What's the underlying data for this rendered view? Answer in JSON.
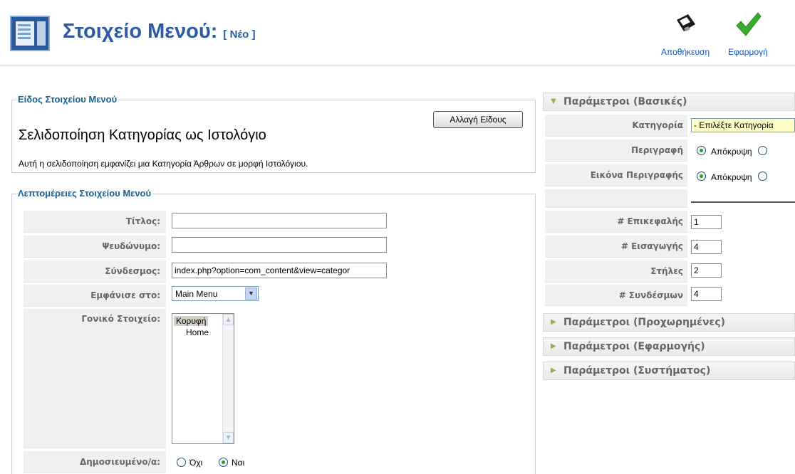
{
  "header": {
    "title": "Στοιχείο Μενού:",
    "title_tag": "[ Νέο ]",
    "icon": "menu-item-icon",
    "toolbar": {
      "save_label": "Αποθήκευση",
      "apply_label": "Εφαρμογή",
      "save_icon": "floppy-disk-icon",
      "apply_icon": "checkmark-icon"
    }
  },
  "menu_type": {
    "legend": "Είδος Στοιχείου Μενού",
    "change_button": "Αλλαγή Είδους",
    "title": "Σελιδοποίηση Κατηγορίας ως Ιστολόγιο",
    "description": "Αυτή η σελιδοποίηση εμφανίζει μια Κατηγορία Άρθρων σε μορφή Ιστολόγιου."
  },
  "details": {
    "legend": "Λεπτομέρειες Στοιχείου Μενού",
    "title_label": "Τίτλος:",
    "title_value": "",
    "alias_label": "Ψευδώνυμο:",
    "alias_value": "",
    "link_label": "Σύνδεσμος:",
    "link_value": "index.php?option=com_content&view=categor",
    "display_in_label": "Εμφάνισε στο:",
    "display_in_value": "Main Menu",
    "parent_label": "Γονικό Στοιχείο:",
    "parent_options": [
      "Κορυφή",
      "Home"
    ],
    "parent_selected": "Κορυφή",
    "published_label": "Δημοσιευμένο/α:",
    "published_no": "Όχι",
    "published_yes": "Ναι",
    "published_value": "Ναι"
  },
  "params": {
    "basic_title": "Παράμετροι (Βασικές)",
    "category_label": "Κατηγορία",
    "category_value": "- Επιλέξτε Κατηγορία",
    "description_label": "Περιγραφή",
    "description_option": "Απόκρυψη",
    "desc_image_label": "Εικόνα Περιγραφής",
    "desc_image_option": "Απόκρυψη",
    "leading_label": "# Επικεφαλής",
    "leading_value": "1",
    "intro_label": "# Εισαγωγής",
    "intro_value": "4",
    "columns_label": "Στήλες",
    "columns_value": "2",
    "links_label": "# Συνδέσμων",
    "links_value": "4",
    "advanced_title": "Παράμετροι (Προχωρημένες)",
    "component_title": "Παράμετροι (Εφαρμογής)",
    "system_title": "Παράμετροι (Συστήματος)"
  },
  "colors": {
    "title_blue": "#2d5aa0",
    "link_blue": "#0b55c4",
    "legend_blue": "#146295",
    "radio_green": "#21a121",
    "arrow_green": "#8bb34b"
  }
}
